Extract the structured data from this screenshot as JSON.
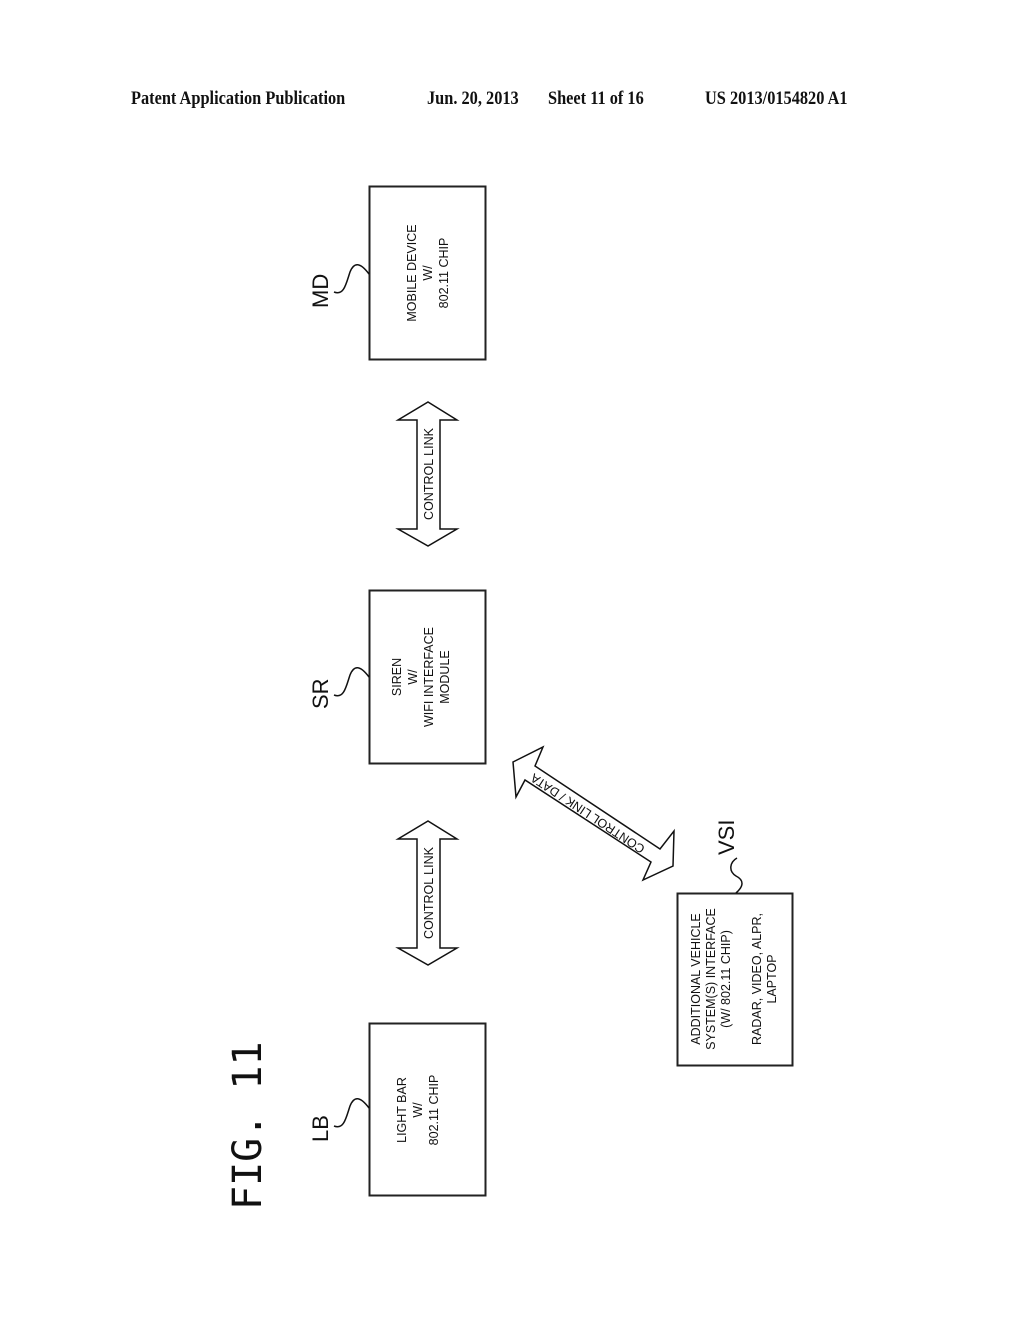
{
  "header": {
    "publication": "Patent Application Publication",
    "date": "Jun. 20, 2013",
    "sheet": "Sheet 11 of 16",
    "number": "US 2013/0154820 A1"
  },
  "figure": {
    "label": "FIG. 11"
  },
  "blocks": {
    "md": {
      "ref": "MD",
      "lines": [
        "MOBILE DEVICE",
        "W/",
        "802.11 CHIP"
      ]
    },
    "sr": {
      "ref": "SR",
      "lines": [
        "SIREN",
        "W/",
        "WIFI INTERFACE",
        "MODULE"
      ]
    },
    "lb": {
      "ref": "LB",
      "lines": [
        "LIGHT BAR",
        "W/",
        "802.11 CHIP"
      ]
    },
    "vsi": {
      "ref": "VSI",
      "lines": [
        "ADDITIONAL VEHICLE",
        "SYSTEM(S) INTERFACE",
        "(W/ 802.11 CHIP)",
        "",
        "RADAR, VIDEO, ALPR,",
        "LAPTOP"
      ]
    }
  },
  "links": {
    "md_sr": "CONTROL LINK",
    "sr_lb": "CONTROL LINK",
    "sr_vsi": "CONTROL LINK / DATA"
  }
}
